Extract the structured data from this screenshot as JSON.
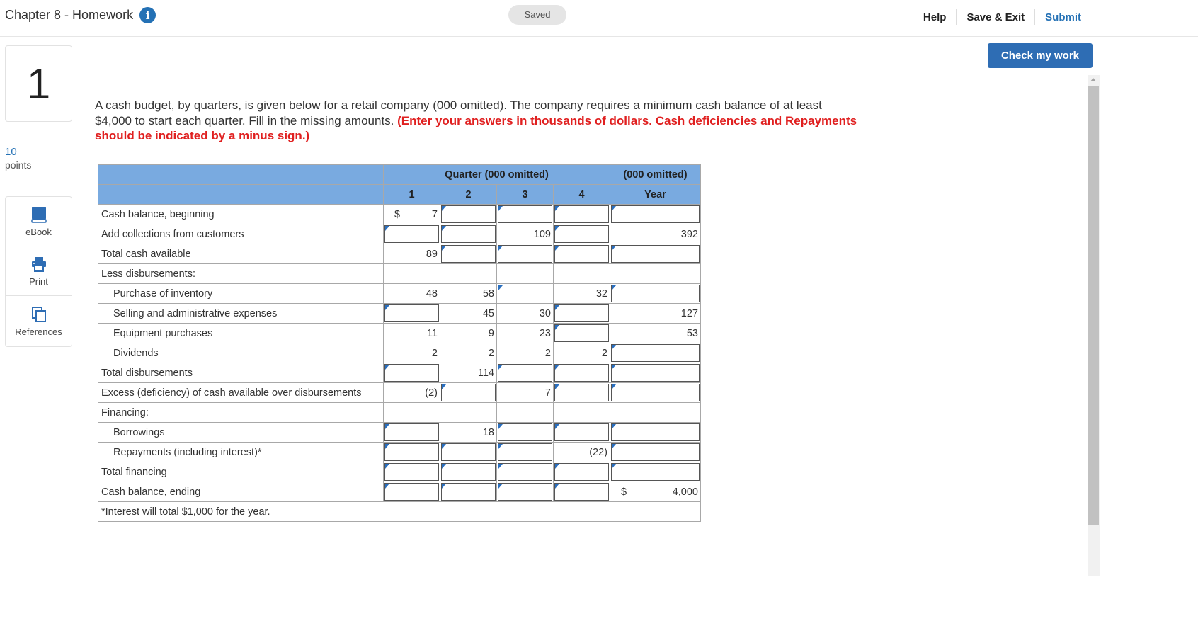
{
  "header": {
    "title": "Chapter 8 - Homework",
    "info_icon": "info-icon",
    "status": "Saved",
    "help": "Help",
    "save_exit": "Save & Exit",
    "submit": "Submit",
    "check_my_work": "Check my work"
  },
  "question": {
    "number": "1",
    "points_value": "10",
    "points_label": "points",
    "text": "A cash budget, by quarters, is given below for a retail company (000 omitted). The company requires a minimum cash balance of at least $4,000 to start each quarter. Fill in the missing amounts. ",
    "instruction": "(Enter your answers in thousands of dollars. Cash deficiencies and Repayments should be indicated by a minus sign.)"
  },
  "tools": [
    {
      "label": "eBook",
      "icon": "book-icon"
    },
    {
      "label": "Print",
      "icon": "printer-icon"
    },
    {
      "label": "References",
      "icon": "copy-icon"
    }
  ],
  "table": {
    "header_quarter": "Quarter (000 omitted)",
    "header_year": "(000 omitted)",
    "columns": [
      "1",
      "2",
      "3",
      "4",
      "Year"
    ],
    "dollar": "$",
    "rows": [
      {
        "label": "Cash balance, beginning",
        "indent": false,
        "cells": [
          "7",
          "",
          "",
          "",
          ""
        ],
        "inputs": [
          false,
          true,
          true,
          true,
          true
        ],
        "dollar_col": 0
      },
      {
        "label": "Add collections from customers",
        "indent": false,
        "cells": [
          "",
          "",
          "109",
          "",
          "392"
        ],
        "inputs": [
          true,
          true,
          false,
          true,
          false
        ]
      },
      {
        "label": "Total cash available",
        "indent": false,
        "cells": [
          "89",
          "",
          "",
          "",
          ""
        ],
        "inputs": [
          false,
          true,
          true,
          true,
          true
        ]
      },
      {
        "label": "Less disbursements:",
        "indent": false,
        "cells": [
          "",
          "",
          "",
          "",
          ""
        ],
        "inputs": [
          false,
          false,
          false,
          false,
          false
        ]
      },
      {
        "label": "Purchase of inventory",
        "indent": true,
        "cells": [
          "48",
          "58",
          "",
          "32",
          ""
        ],
        "inputs": [
          false,
          false,
          true,
          false,
          true
        ]
      },
      {
        "label": "Selling and administrative expenses",
        "indent": true,
        "cells": [
          "",
          "45",
          "30",
          "",
          "127"
        ],
        "inputs": [
          true,
          false,
          false,
          true,
          false
        ]
      },
      {
        "label": "Equipment purchases",
        "indent": true,
        "cells": [
          "11",
          "9",
          "23",
          "",
          "53"
        ],
        "inputs": [
          false,
          false,
          false,
          true,
          false
        ]
      },
      {
        "label": "Dividends",
        "indent": true,
        "cells": [
          "2",
          "2",
          "2",
          "2",
          ""
        ],
        "inputs": [
          false,
          false,
          false,
          false,
          true
        ]
      },
      {
        "label": "Total disbursements",
        "indent": false,
        "cells": [
          "",
          "114",
          "",
          "",
          ""
        ],
        "inputs": [
          true,
          false,
          true,
          true,
          true
        ]
      },
      {
        "label": "Excess (deficiency) of cash available over disbursements",
        "indent": false,
        "cells": [
          "(2)",
          "",
          "7",
          "",
          ""
        ],
        "inputs": [
          false,
          true,
          false,
          true,
          true
        ]
      },
      {
        "label": "Financing:",
        "indent": false,
        "cells": [
          "",
          "",
          "",
          "",
          ""
        ],
        "inputs": [
          false,
          false,
          false,
          false,
          false
        ]
      },
      {
        "label": "Borrowings",
        "indent": true,
        "cells": [
          "",
          "18",
          "",
          "",
          ""
        ],
        "inputs": [
          true,
          false,
          true,
          true,
          true
        ]
      },
      {
        "label": "Repayments (including interest)*",
        "indent": true,
        "cells": [
          "",
          "",
          "",
          "(22)",
          ""
        ],
        "inputs": [
          true,
          true,
          true,
          false,
          true
        ]
      },
      {
        "label": "Total financing",
        "indent": false,
        "cells": [
          "",
          "",
          "",
          "",
          ""
        ],
        "inputs": [
          true,
          true,
          true,
          true,
          true
        ]
      },
      {
        "label": "Cash balance, ending",
        "indent": false,
        "cells": [
          "",
          "",
          "",
          "",
          "4,000"
        ],
        "inputs": [
          true,
          true,
          true,
          true,
          false
        ],
        "dollar_col": 4
      }
    ],
    "footnote": "*Interest will total $1,000 for the year."
  }
}
